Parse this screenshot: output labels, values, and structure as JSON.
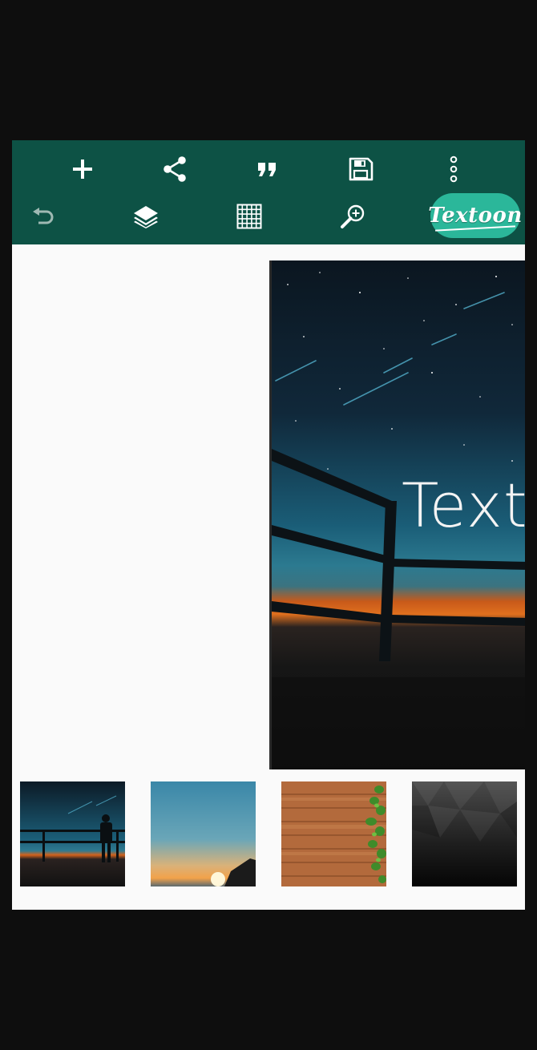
{
  "toolbar": {
    "top_row": [
      {
        "name": "add-icon"
      },
      {
        "name": "share-icon"
      },
      {
        "name": "quote-icon"
      },
      {
        "name": "save-icon"
      },
      {
        "name": "more-vert-icon"
      }
    ],
    "bottom_row": [
      {
        "name": "undo-icon"
      },
      {
        "name": "layers-icon"
      },
      {
        "name": "grid-icon"
      },
      {
        "name": "zoom-in-icon"
      }
    ],
    "brand_label": "Textoon",
    "colors": {
      "bar": "#0d5245",
      "brand_pill": "#2bb79a",
      "icon": "#ffffff",
      "undo_disabled": "#9fb9b3"
    }
  },
  "canvas": {
    "text": "Text",
    "background": "night-sky-balcony"
  },
  "backgrounds": [
    {
      "name": "night-sky-balcony"
    },
    {
      "name": "sunset-sea"
    },
    {
      "name": "wood-planks-ivy"
    },
    {
      "name": "dark-geometric"
    }
  ]
}
